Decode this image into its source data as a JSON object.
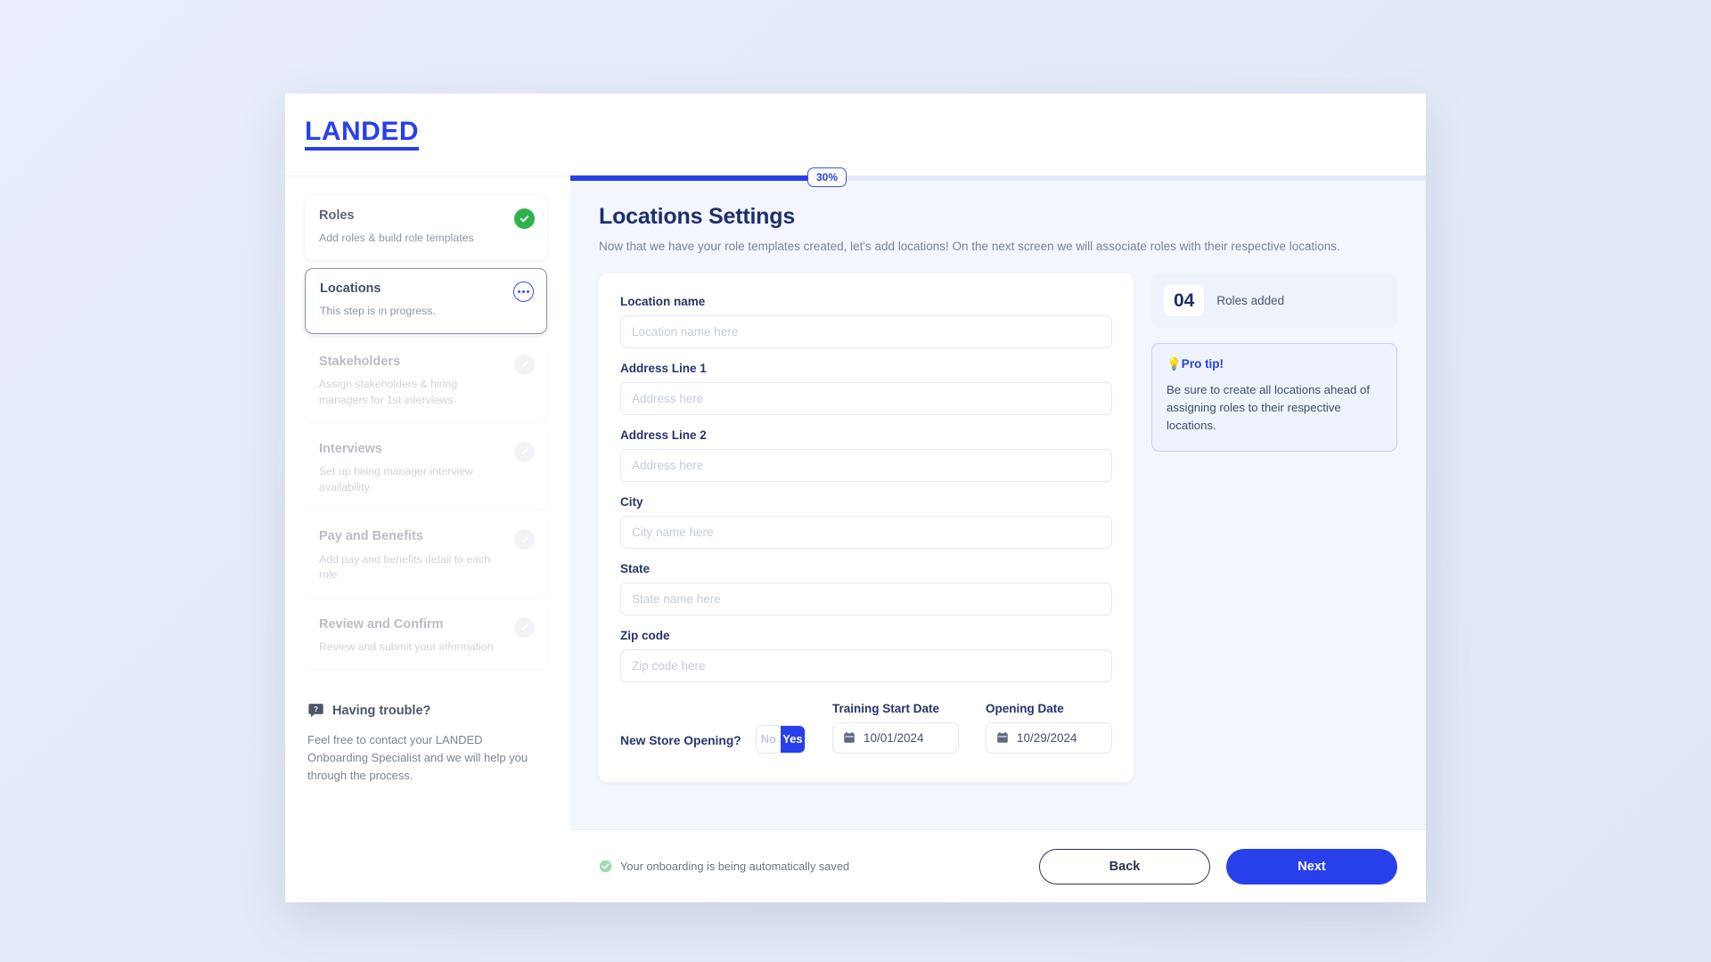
{
  "brand": {
    "logo": "LANDED"
  },
  "progress": {
    "percent_label": "30%",
    "percent_value": 30
  },
  "sidebar": {
    "steps": [
      {
        "title": "Roles",
        "desc": "Add roles & build role templates",
        "state": "done",
        "icon": "check-circle-icon"
      },
      {
        "title": "Locations",
        "desc": "This step is in progress.",
        "state": "active",
        "icon": "ellipsis-circle-icon"
      },
      {
        "title": "Stakeholders",
        "desc": "Assign stakeholders & hiring managers for 1st interviews",
        "state": "locked",
        "icon": "edit-circle-icon"
      },
      {
        "title": "Interviews",
        "desc": "Set up hiring manager interview availability.",
        "state": "locked",
        "icon": "edit-circle-icon"
      },
      {
        "title": "Pay and Benefits",
        "desc": "Add pay and benefits detail to each role",
        "state": "locked",
        "icon": "edit-circle-icon"
      },
      {
        "title": "Review and Confirm",
        "desc": "Review and submit your information",
        "state": "locked",
        "icon": "edit-circle-icon"
      }
    ],
    "help": {
      "icon": "question-bubble-icon",
      "title": "Having trouble?",
      "text": "Feel free to contact your LANDED Onboarding Specialist and we will help you through the process."
    }
  },
  "main": {
    "title": "Locations Settings",
    "subtitle": "Now that we have your role templates created, let's add locations! On the next screen we will associate roles with their respective locations.",
    "fields": [
      {
        "label": "Location name",
        "value": "",
        "placeholder": "Location name here"
      },
      {
        "label": "Address Line 1",
        "value": "",
        "placeholder": "Address here"
      },
      {
        "label": "Address Line 2",
        "value": "",
        "placeholder": "Address here"
      },
      {
        "label": "City",
        "value": "",
        "placeholder": "City name here"
      },
      {
        "label": "State",
        "value": "",
        "placeholder": "State name here"
      },
      {
        "label": "Zip code",
        "value": "",
        "placeholder": "Zip code here"
      }
    ],
    "store_opening": {
      "question": "New Store Opening?",
      "options": [
        "No",
        "Yes"
      ],
      "selected": "Yes"
    },
    "dates": [
      {
        "label": "Training Start Date",
        "value": "10/01/2024",
        "icon": "calendar-icon"
      },
      {
        "label": "Opening Date",
        "value": "10/29/2024",
        "icon": "calendar-icon"
      }
    ]
  },
  "rail": {
    "roles_card": {
      "count": "04",
      "text": "Roles added"
    },
    "tip_card": {
      "heading": "💡Pro tip!",
      "body": "Be sure to create all locations ahead of assigning roles to their respective locations."
    }
  },
  "footer": {
    "save_note": "Your onboarding is being automatically saved",
    "save_icon": "check-circle-icon",
    "back_label": "Back",
    "next_label": "Next"
  },
  "colors": {
    "brand_blue": "#2840ec",
    "title_navy": "#1e2f6b",
    "success_green": "#2cb34a"
  }
}
